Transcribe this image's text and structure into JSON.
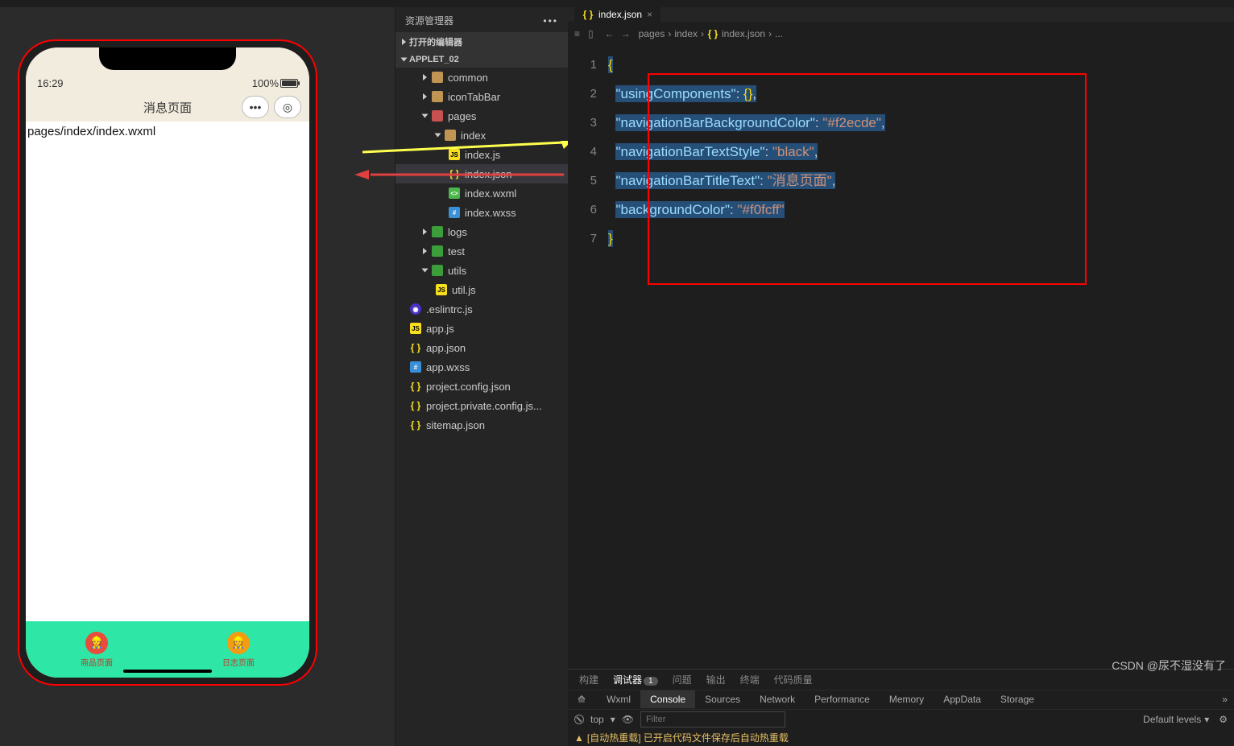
{
  "preview": {
    "time": "16:29",
    "battery": "100%",
    "navTitle": "消息页面",
    "bodyText": "pages/index/index.wxml",
    "tabs": [
      {
        "label": "商品页面"
      },
      {
        "label": "日志页面"
      }
    ]
  },
  "explorer": {
    "title": "资源管理器",
    "openEditors": "打开的编辑器",
    "project": "APPLET_02",
    "tree": [
      {
        "indent": 1,
        "icon": "tri",
        "label": "common",
        "type": "folder"
      },
      {
        "indent": 1,
        "icon": "tri",
        "label": "iconTabBar",
        "type": "folder"
      },
      {
        "indent": 1,
        "icon": "tri-open",
        "label": "pages",
        "type": "folder-red"
      },
      {
        "indent": 2,
        "icon": "tri-open",
        "label": "index",
        "type": "folder"
      },
      {
        "indent": 3,
        "icon": "js",
        "label": "index.js"
      },
      {
        "indent": 3,
        "icon": "json",
        "label": "index.json",
        "selected": true
      },
      {
        "indent": 3,
        "icon": "wxml",
        "label": "index.wxml"
      },
      {
        "indent": 3,
        "icon": "wxss",
        "label": "index.wxss"
      },
      {
        "indent": 1,
        "icon": "tri",
        "label": "logs",
        "type": "folder-green"
      },
      {
        "indent": 1,
        "icon": "tri",
        "label": "test",
        "type": "folder-green"
      },
      {
        "indent": 1,
        "icon": "tri-open",
        "label": "utils",
        "type": "folder-green"
      },
      {
        "indent": 2,
        "icon": "js",
        "label": "util.js"
      },
      {
        "indent": 0,
        "icon": "es",
        "label": ".eslintrc.js"
      },
      {
        "indent": 0,
        "icon": "js",
        "label": "app.js"
      },
      {
        "indent": 0,
        "icon": "json",
        "label": "app.json"
      },
      {
        "indent": 0,
        "icon": "wxss",
        "label": "app.wxss"
      },
      {
        "indent": 0,
        "icon": "json",
        "label": "project.config.json"
      },
      {
        "indent": 0,
        "icon": "json",
        "label": "project.private.config.js..."
      },
      {
        "indent": 0,
        "icon": "json",
        "label": "sitemap.json"
      }
    ]
  },
  "editor": {
    "activeTab": "index.json",
    "crumbs": [
      "pages",
      "index",
      "index.json",
      "..."
    ],
    "lines": [
      1,
      2,
      3,
      4,
      5,
      6,
      7
    ],
    "json": {
      "k1": "usingComponents",
      "v1": "{}",
      "k2": "navigationBarBackgroundColor",
      "v2": "#f2ecde",
      "k3": "navigationBarTextStyle",
      "v3": "black",
      "k4": "navigationBarTitleText",
      "v4": "消息页面",
      "k5": "backgroundColor",
      "v5": "#f0fcff"
    }
  },
  "bottom": {
    "tabs": [
      "构建",
      "调试器",
      "问题",
      "输出",
      "终端",
      "代码质量"
    ],
    "debuggerBadge": "1",
    "consoleTabs": [
      "Wxml",
      "Console",
      "Sources",
      "Network",
      "Performance",
      "Memory",
      "AppData",
      "Storage"
    ],
    "topContext": "top",
    "filterPlaceholder": "Filter",
    "levels": "Default levels",
    "log": "[自动热重载] 已开启代码文件保存后自动热重载"
  },
  "watermark": "CSDN @尿不湿没有了"
}
